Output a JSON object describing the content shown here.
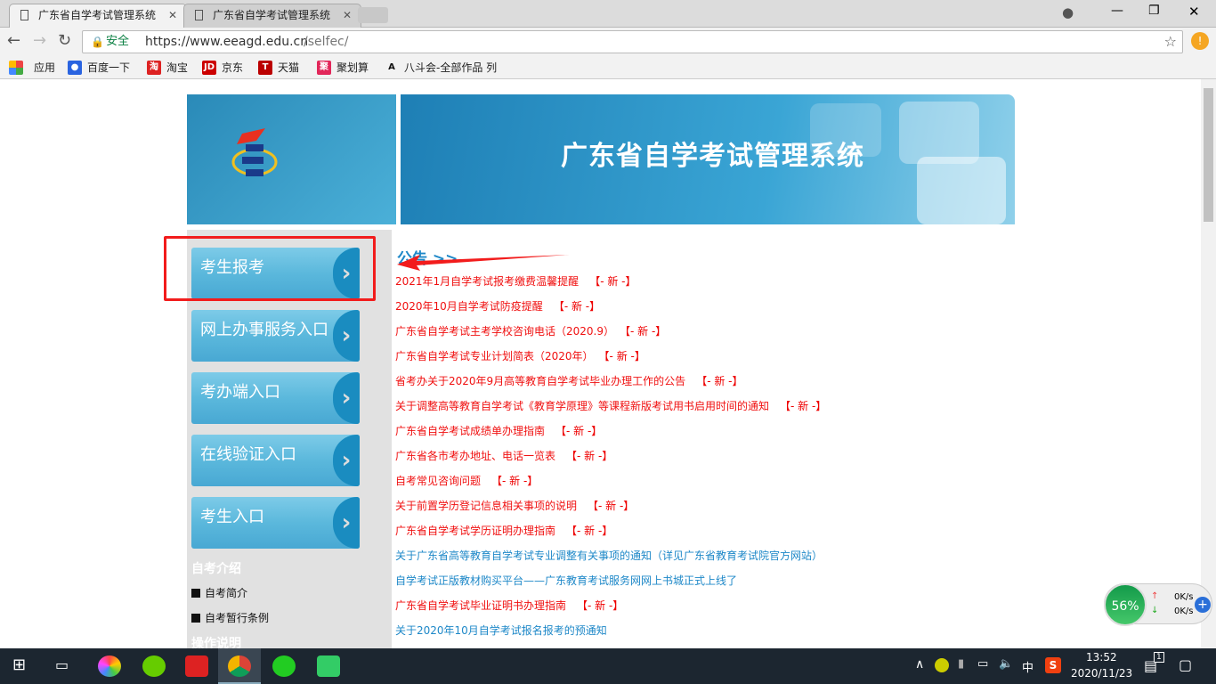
{
  "browser": {
    "tabs": [
      {
        "title": "广东省自学考试管理系统",
        "active": true
      },
      {
        "title": "广东省自学考试管理系统",
        "active": false
      }
    ],
    "security_label": "安全",
    "url_host": "https://www.eeagd.edu.cn",
    "url_path": "/selfec/",
    "bookmarks": [
      {
        "label": "应用",
        "icon": "apps-grid-icon",
        "color": "#e44"
      },
      {
        "label": "百度一下",
        "icon": "baidu-paw-icon",
        "color": "#2a64e0"
      },
      {
        "label": "淘宝",
        "icon": "taobao-icon",
        "color": "#d22"
      },
      {
        "label": "京东",
        "icon": "jd-icon",
        "color": "#c00"
      },
      {
        "label": "天猫",
        "icon": "tmall-icon",
        "color": "#b00"
      },
      {
        "label": "聚划算",
        "icon": "juhuasuan-icon",
        "color": "#e2275a"
      },
      {
        "label": "八斗会-全部作品 列",
        "icon": "badouhui-icon",
        "color": "#fff"
      }
    ]
  },
  "banner": {
    "title": "广东省自学考试管理系统"
  },
  "sidebar": {
    "buttons": [
      "考生报考",
      "网上办事服务入口",
      "考办端入口",
      "在线验证入口",
      "考生入口"
    ],
    "section1": "自考介绍",
    "links": [
      "自考简介",
      "自考暂行条例"
    ],
    "section2": "操作说明"
  },
  "notices": {
    "title": "公告 >>",
    "new_tag": "【- 新 -】",
    "items": [
      {
        "text": "2021年1月自学考试报考缴费温馨提醒",
        "new": true,
        "color": "red"
      },
      {
        "text": "2020年10月自学考试防疫提醒",
        "new": true,
        "color": "red"
      },
      {
        "text": "广东省自学考试主考学校咨询电话（2020.9）",
        "new": true,
        "color": "red"
      },
      {
        "text": "广东省自学考试专业计划简表（2020年）",
        "new": true,
        "color": "red"
      },
      {
        "text": "省考办关于2020年9月高等教育自学考试毕业办理工作的公告",
        "new": true,
        "color": "red"
      },
      {
        "text": "关于调整高等教育自学考试《教育学原理》等课程新版考试用书启用时间的通知",
        "new": true,
        "color": "red"
      },
      {
        "text": "广东省自学考试成绩单办理指南",
        "new": true,
        "color": "red"
      },
      {
        "text": "广东省各市考办地址、电话一览表",
        "new": true,
        "color": "red"
      },
      {
        "text": "自考常见咨询问题",
        "new": true,
        "color": "red"
      },
      {
        "text": "关于前置学历登记信息相关事项的说明",
        "new": true,
        "color": "red"
      },
      {
        "text": "广东省自学考试学历证明办理指南",
        "new": true,
        "color": "red"
      },
      {
        "text": "关于广东省高等教育自学考试专业调整有关事项的通知（详见广东省教育考试院官方网站）",
        "new": false,
        "color": "blue"
      },
      {
        "text": "自学考试正版教材购买平台——广东教育考试服务网网上书城正式上线了",
        "new": false,
        "color": "blue"
      },
      {
        "text": "广东省自学考试毕业证明书办理指南",
        "new": true,
        "color": "red"
      },
      {
        "text": "关于2020年10月自学考试报名报考的预通知",
        "new": false,
        "color": "blue"
      }
    ]
  },
  "net_widget": {
    "percent": "56%",
    "up": "0K/s",
    "down": "0K/s"
  },
  "taskbar": {
    "time": "13:52",
    "date": "2020/11/23",
    "ime": "中",
    "notifications": "1"
  }
}
